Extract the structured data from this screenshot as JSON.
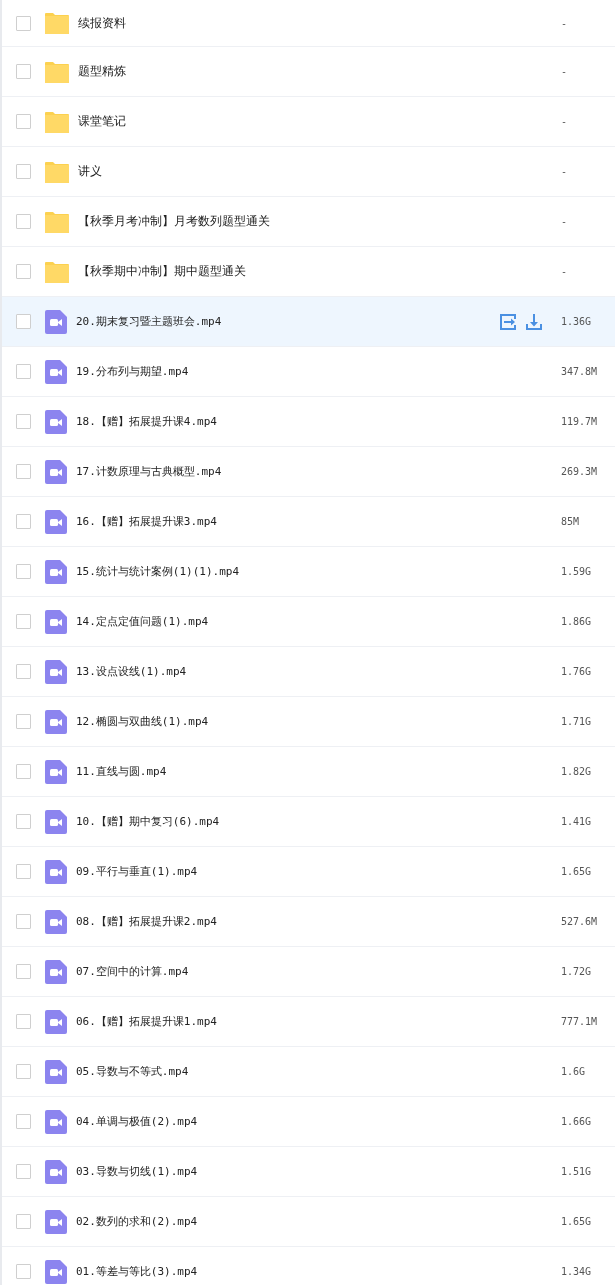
{
  "files": [
    {
      "kind": "folder",
      "name": "续报资料",
      "size": "-",
      "checked": false,
      "hovered": false
    },
    {
      "kind": "folder",
      "name": "题型精炼",
      "size": "-",
      "checked": false,
      "hovered": false
    },
    {
      "kind": "folder",
      "name": "课堂笔记",
      "size": "-",
      "checked": false,
      "hovered": false
    },
    {
      "kind": "folder",
      "name": "讲义",
      "size": "-",
      "checked": false,
      "hovered": false
    },
    {
      "kind": "folder",
      "name": "【秋季月考冲制】月考数列题型通关",
      "size": "-",
      "checked": false,
      "hovered": false
    },
    {
      "kind": "folder",
      "name": "【秋季期中冲制】期中题型通关",
      "size": "-",
      "checked": false,
      "hovered": false
    },
    {
      "kind": "video",
      "name": "20.期末复习暨主题班会.mp4",
      "size": "1.36G",
      "checked": false,
      "hovered": true
    },
    {
      "kind": "video",
      "name": "19.分布列与期望.mp4",
      "size": "347.8M",
      "checked": false,
      "hovered": false
    },
    {
      "kind": "video",
      "name": "18.【赠】拓展提升课4.mp4",
      "size": "119.7M",
      "checked": false,
      "hovered": false
    },
    {
      "kind": "video",
      "name": "17.计数原理与古典概型.mp4",
      "size": "269.3M",
      "checked": false,
      "hovered": false
    },
    {
      "kind": "video",
      "name": "16.【赠】拓展提升课3.mp4",
      "size": "85M",
      "checked": false,
      "hovered": false
    },
    {
      "kind": "video",
      "name": "15.统计与统计案例(1)(1).mp4",
      "size": "1.59G",
      "checked": false,
      "hovered": false
    },
    {
      "kind": "video",
      "name": "14.定点定值问题(1).mp4",
      "size": "1.86G",
      "checked": false,
      "hovered": false
    },
    {
      "kind": "video",
      "name": "13.设点设线(1).mp4",
      "size": "1.76G",
      "checked": false,
      "hovered": false
    },
    {
      "kind": "video",
      "name": "12.椭圆与双曲线(1).mp4",
      "size": "1.71G",
      "checked": false,
      "hovered": false
    },
    {
      "kind": "video",
      "name": "11.直线与圆.mp4",
      "size": "1.82G",
      "checked": false,
      "hovered": false
    },
    {
      "kind": "video",
      "name": "10.【赠】期中复习(6).mp4",
      "size": "1.41G",
      "checked": false,
      "hovered": false
    },
    {
      "kind": "video",
      "name": "09.平行与垂直(1).mp4",
      "size": "1.65G",
      "checked": false,
      "hovered": false
    },
    {
      "kind": "video",
      "name": "08.【赠】拓展提升课2.mp4",
      "size": "527.6M",
      "checked": false,
      "hovered": false
    },
    {
      "kind": "video",
      "name": "07.空间中的计算.mp4",
      "size": "1.72G",
      "checked": false,
      "hovered": false
    },
    {
      "kind": "video",
      "name": "06.【赠】拓展提升课1.mp4",
      "size": "777.1M",
      "checked": false,
      "hovered": false
    },
    {
      "kind": "video",
      "name": "05.导数与不等式.mp4",
      "size": "1.6G",
      "checked": false,
      "hovered": false
    },
    {
      "kind": "video",
      "name": "04.单调与极值(2).mp4",
      "size": "1.66G",
      "checked": false,
      "hovered": false
    },
    {
      "kind": "video",
      "name": "03.导数与切线(1).mp4",
      "size": "1.51G",
      "checked": false,
      "hovered": false
    },
    {
      "kind": "video",
      "name": "02.数列的求和(2).mp4",
      "size": "1.65G",
      "checked": false,
      "hovered": false
    },
    {
      "kind": "video",
      "name": "01.等差与等比(3).mp4",
      "size": "1.34G",
      "checked": false,
      "hovered": false
    }
  ]
}
